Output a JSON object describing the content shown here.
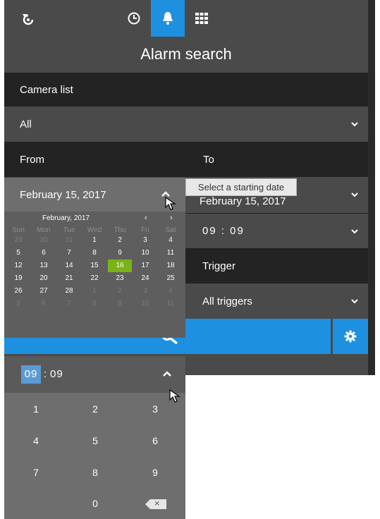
{
  "app": {
    "title": "Alarm search",
    "accent_color": "#1e90e0",
    "selected_day_color": "#7ab317"
  },
  "toolbar": {
    "items": [
      {
        "icon": "rotate-icon"
      },
      {
        "icon": "clock-icon"
      },
      {
        "icon": "bell-icon",
        "active": true
      },
      {
        "icon": "grid-icon"
      }
    ]
  },
  "camera_list": {
    "label": "Camera list",
    "value": "All"
  },
  "from": {
    "label": "From",
    "date": "February 15, 2017"
  },
  "to": {
    "label": "To",
    "date": "February 15, 2017",
    "time": "09 : 09"
  },
  "trigger": {
    "label": "Trigger",
    "value": "All triggers"
  },
  "tooltip": "Select a starting date",
  "calendar": {
    "month_label": "February, 2017",
    "prev": "‹",
    "next": "›",
    "weekdays": [
      "Sun",
      "Mon",
      "Tue",
      "Wed",
      "Thu",
      "Fri",
      "Sat"
    ],
    "weeks": [
      [
        "29",
        "30",
        "31",
        "1",
        "2",
        "3",
        "4"
      ],
      [
        "5",
        "6",
        "7",
        "8",
        "9",
        "10",
        "11"
      ],
      [
        "12",
        "13",
        "14",
        "15",
        "16",
        "17",
        "18"
      ],
      [
        "19",
        "20",
        "21",
        "22",
        "23",
        "24",
        "25"
      ],
      [
        "26",
        "27",
        "28",
        "1",
        "2",
        "3",
        "4"
      ],
      [
        "5",
        "6",
        "7",
        "8",
        "9",
        "10",
        "11"
      ]
    ],
    "selected": "16"
  },
  "time_picker": {
    "hours": "09",
    "colon": ":",
    "minutes": "09",
    "keys": [
      "1",
      "2",
      "3",
      "4",
      "5",
      "6",
      "7",
      "8",
      "9",
      "0"
    ],
    "backspace": "×"
  }
}
